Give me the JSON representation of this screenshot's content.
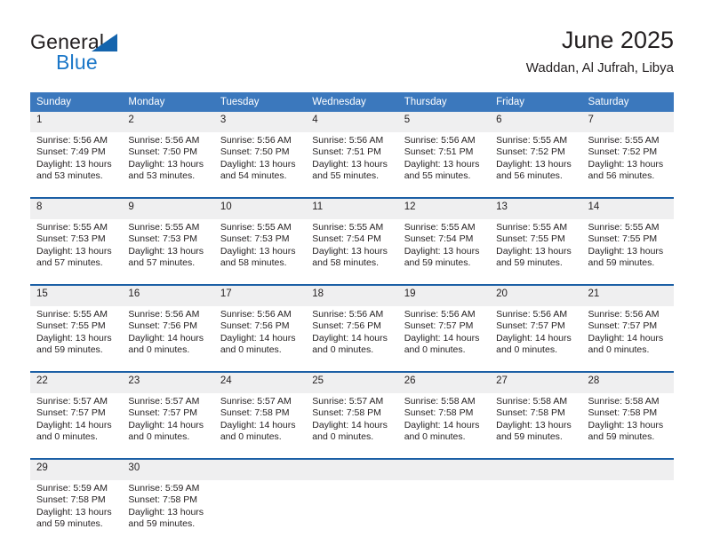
{
  "brand": {
    "name_part1": "General",
    "name_part2": "Blue"
  },
  "header": {
    "title": "June 2025",
    "subtitle": "Waddan, Al Jufrah, Libya"
  },
  "colors": {
    "header_blue": "#3b78bd",
    "separator_blue": "#1b5fa5",
    "daynum_background": "#efeff0",
    "brand_blue": "#1b77c8",
    "text": "#231f20"
  },
  "weekday_headers": [
    "Sunday",
    "Monday",
    "Tuesday",
    "Wednesday",
    "Thursday",
    "Friday",
    "Saturday"
  ],
  "weeks": [
    {
      "days": [
        {
          "num": "1",
          "sunrise": "Sunrise: 5:56 AM",
          "sunset": "Sunset: 7:49 PM",
          "daylight": "Daylight: 13 hours and 53 minutes."
        },
        {
          "num": "2",
          "sunrise": "Sunrise: 5:56 AM",
          "sunset": "Sunset: 7:50 PM",
          "daylight": "Daylight: 13 hours and 53 minutes."
        },
        {
          "num": "3",
          "sunrise": "Sunrise: 5:56 AM",
          "sunset": "Sunset: 7:50 PM",
          "daylight": "Daylight: 13 hours and 54 minutes."
        },
        {
          "num": "4",
          "sunrise": "Sunrise: 5:56 AM",
          "sunset": "Sunset: 7:51 PM",
          "daylight": "Daylight: 13 hours and 55 minutes."
        },
        {
          "num": "5",
          "sunrise": "Sunrise: 5:56 AM",
          "sunset": "Sunset: 7:51 PM",
          "daylight": "Daylight: 13 hours and 55 minutes."
        },
        {
          "num": "6",
          "sunrise": "Sunrise: 5:55 AM",
          "sunset": "Sunset: 7:52 PM",
          "daylight": "Daylight: 13 hours and 56 minutes."
        },
        {
          "num": "7",
          "sunrise": "Sunrise: 5:55 AM",
          "sunset": "Sunset: 7:52 PM",
          "daylight": "Daylight: 13 hours and 56 minutes."
        }
      ]
    },
    {
      "days": [
        {
          "num": "8",
          "sunrise": "Sunrise: 5:55 AM",
          "sunset": "Sunset: 7:53 PM",
          "daylight": "Daylight: 13 hours and 57 minutes."
        },
        {
          "num": "9",
          "sunrise": "Sunrise: 5:55 AM",
          "sunset": "Sunset: 7:53 PM",
          "daylight": "Daylight: 13 hours and 57 minutes."
        },
        {
          "num": "10",
          "sunrise": "Sunrise: 5:55 AM",
          "sunset": "Sunset: 7:53 PM",
          "daylight": "Daylight: 13 hours and 58 minutes."
        },
        {
          "num": "11",
          "sunrise": "Sunrise: 5:55 AM",
          "sunset": "Sunset: 7:54 PM",
          "daylight": "Daylight: 13 hours and 58 minutes."
        },
        {
          "num": "12",
          "sunrise": "Sunrise: 5:55 AM",
          "sunset": "Sunset: 7:54 PM",
          "daylight": "Daylight: 13 hours and 59 minutes."
        },
        {
          "num": "13",
          "sunrise": "Sunrise: 5:55 AM",
          "sunset": "Sunset: 7:55 PM",
          "daylight": "Daylight: 13 hours and 59 minutes."
        },
        {
          "num": "14",
          "sunrise": "Sunrise: 5:55 AM",
          "sunset": "Sunset: 7:55 PM",
          "daylight": "Daylight: 13 hours and 59 minutes."
        }
      ]
    },
    {
      "days": [
        {
          "num": "15",
          "sunrise": "Sunrise: 5:55 AM",
          "sunset": "Sunset: 7:55 PM",
          "daylight": "Daylight: 13 hours and 59 minutes."
        },
        {
          "num": "16",
          "sunrise": "Sunrise: 5:56 AM",
          "sunset": "Sunset: 7:56 PM",
          "daylight": "Daylight: 14 hours and 0 minutes."
        },
        {
          "num": "17",
          "sunrise": "Sunrise: 5:56 AM",
          "sunset": "Sunset: 7:56 PM",
          "daylight": "Daylight: 14 hours and 0 minutes."
        },
        {
          "num": "18",
          "sunrise": "Sunrise: 5:56 AM",
          "sunset": "Sunset: 7:56 PM",
          "daylight": "Daylight: 14 hours and 0 minutes."
        },
        {
          "num": "19",
          "sunrise": "Sunrise: 5:56 AM",
          "sunset": "Sunset: 7:57 PM",
          "daylight": "Daylight: 14 hours and 0 minutes."
        },
        {
          "num": "20",
          "sunrise": "Sunrise: 5:56 AM",
          "sunset": "Sunset: 7:57 PM",
          "daylight": "Daylight: 14 hours and 0 minutes."
        },
        {
          "num": "21",
          "sunrise": "Sunrise: 5:56 AM",
          "sunset": "Sunset: 7:57 PM",
          "daylight": "Daylight: 14 hours and 0 minutes."
        }
      ]
    },
    {
      "days": [
        {
          "num": "22",
          "sunrise": "Sunrise: 5:57 AM",
          "sunset": "Sunset: 7:57 PM",
          "daylight": "Daylight: 14 hours and 0 minutes."
        },
        {
          "num": "23",
          "sunrise": "Sunrise: 5:57 AM",
          "sunset": "Sunset: 7:57 PM",
          "daylight": "Daylight: 14 hours and 0 minutes."
        },
        {
          "num": "24",
          "sunrise": "Sunrise: 5:57 AM",
          "sunset": "Sunset: 7:58 PM",
          "daylight": "Daylight: 14 hours and 0 minutes."
        },
        {
          "num": "25",
          "sunrise": "Sunrise: 5:57 AM",
          "sunset": "Sunset: 7:58 PM",
          "daylight": "Daylight: 14 hours and 0 minutes."
        },
        {
          "num": "26",
          "sunrise": "Sunrise: 5:58 AM",
          "sunset": "Sunset: 7:58 PM",
          "daylight": "Daylight: 14 hours and 0 minutes."
        },
        {
          "num": "27",
          "sunrise": "Sunrise: 5:58 AM",
          "sunset": "Sunset: 7:58 PM",
          "daylight": "Daylight: 13 hours and 59 minutes."
        },
        {
          "num": "28",
          "sunrise": "Sunrise: 5:58 AM",
          "sunset": "Sunset: 7:58 PM",
          "daylight": "Daylight: 13 hours and 59 minutes."
        }
      ]
    },
    {
      "days": [
        {
          "num": "29",
          "sunrise": "Sunrise: 5:59 AM",
          "sunset": "Sunset: 7:58 PM",
          "daylight": "Daylight: 13 hours and 59 minutes."
        },
        {
          "num": "30",
          "sunrise": "Sunrise: 5:59 AM",
          "sunset": "Sunset: 7:58 PM",
          "daylight": "Daylight: 13 hours and 59 minutes."
        },
        {
          "num": "",
          "sunrise": "",
          "sunset": "",
          "daylight": ""
        },
        {
          "num": "",
          "sunrise": "",
          "sunset": "",
          "daylight": ""
        },
        {
          "num": "",
          "sunrise": "",
          "sunset": "",
          "daylight": ""
        },
        {
          "num": "",
          "sunrise": "",
          "sunset": "",
          "daylight": ""
        },
        {
          "num": "",
          "sunrise": "",
          "sunset": "",
          "daylight": ""
        }
      ]
    }
  ]
}
